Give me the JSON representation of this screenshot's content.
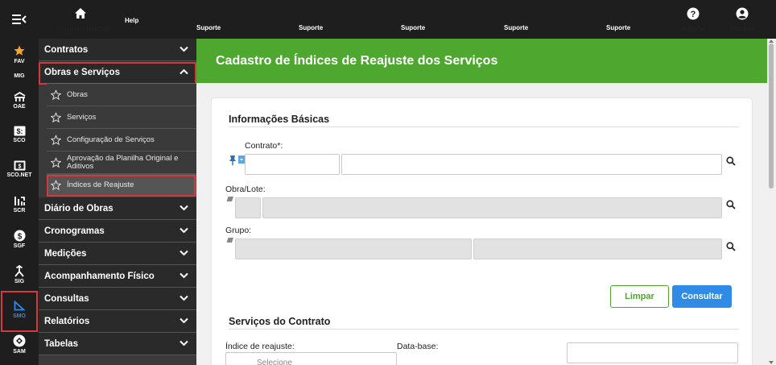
{
  "topbar": {
    "menu_toggle": "menu-toggle",
    "home_label": "Página Inicial",
    "help_label": "Help",
    "support_labels": [
      "Suporte",
      "Suporte",
      "Suporte",
      "Suporte",
      "Suporte"
    ],
    "ajuda_label": "Ajuda",
    "profile_label": "Profile"
  },
  "iconbar": {
    "items": [
      {
        "label": "FAV",
        "icon": "star-icon"
      },
      {
        "label": "MIG",
        "icon": ""
      },
      {
        "label": "OAE",
        "icon": "bridge-icon"
      },
      {
        "label": "SCO",
        "icon": "money-icon"
      },
      {
        "label": "SCO.NET",
        "icon": "money-box-icon"
      },
      {
        "label": "SCR",
        "icon": "chart-icon"
      },
      {
        "label": "SGF",
        "icon": "dollar-circle-icon"
      },
      {
        "label": "SIG",
        "icon": "fork-icon"
      },
      {
        "label": "SMO",
        "icon": "triangle-ruler-icon"
      },
      {
        "label": "SAM",
        "icon": "compass-icon"
      }
    ]
  },
  "menu": {
    "sections": [
      {
        "label": "Contratos"
      },
      {
        "label": "Obras e Serviços"
      },
      {
        "label": "Diário de Obras"
      },
      {
        "label": "Cronogramas"
      },
      {
        "label": "Medições"
      },
      {
        "label": "Acompanhamento Físico"
      },
      {
        "label": "Consultas"
      },
      {
        "label": "Relatórios"
      },
      {
        "label": "Tabelas"
      }
    ],
    "subitems": [
      {
        "label": "Obras"
      },
      {
        "label": "Serviços"
      },
      {
        "label": "Configuração de Serviços"
      },
      {
        "label": "Aprovação da Planilha Original e Aditivos"
      },
      {
        "label": "Índices de Reajuste"
      }
    ]
  },
  "page": {
    "title": "Cadastro de Índices de Reajuste dos Serviços",
    "basic_info_title": "Informações Básicas",
    "contrato_label": "Contrato*:",
    "obra_label": "Obra/Lote:",
    "grupo_label": "Grupo:",
    "limpar_label": "Limpar",
    "consultar_label": "Consultar",
    "services_title": "Serviços do Contrato",
    "indice_label": "Índice de reajuste:",
    "database_label": "Data-base:",
    "select_placeholder": "Selecione"
  },
  "colors": {
    "topbar_bg": "#1e1e1e",
    "banner_green": "#4ea72f",
    "consultar_blue": "#2f8be6",
    "highlight_red": "#d9363e",
    "fav_star": "#f5a623"
  }
}
